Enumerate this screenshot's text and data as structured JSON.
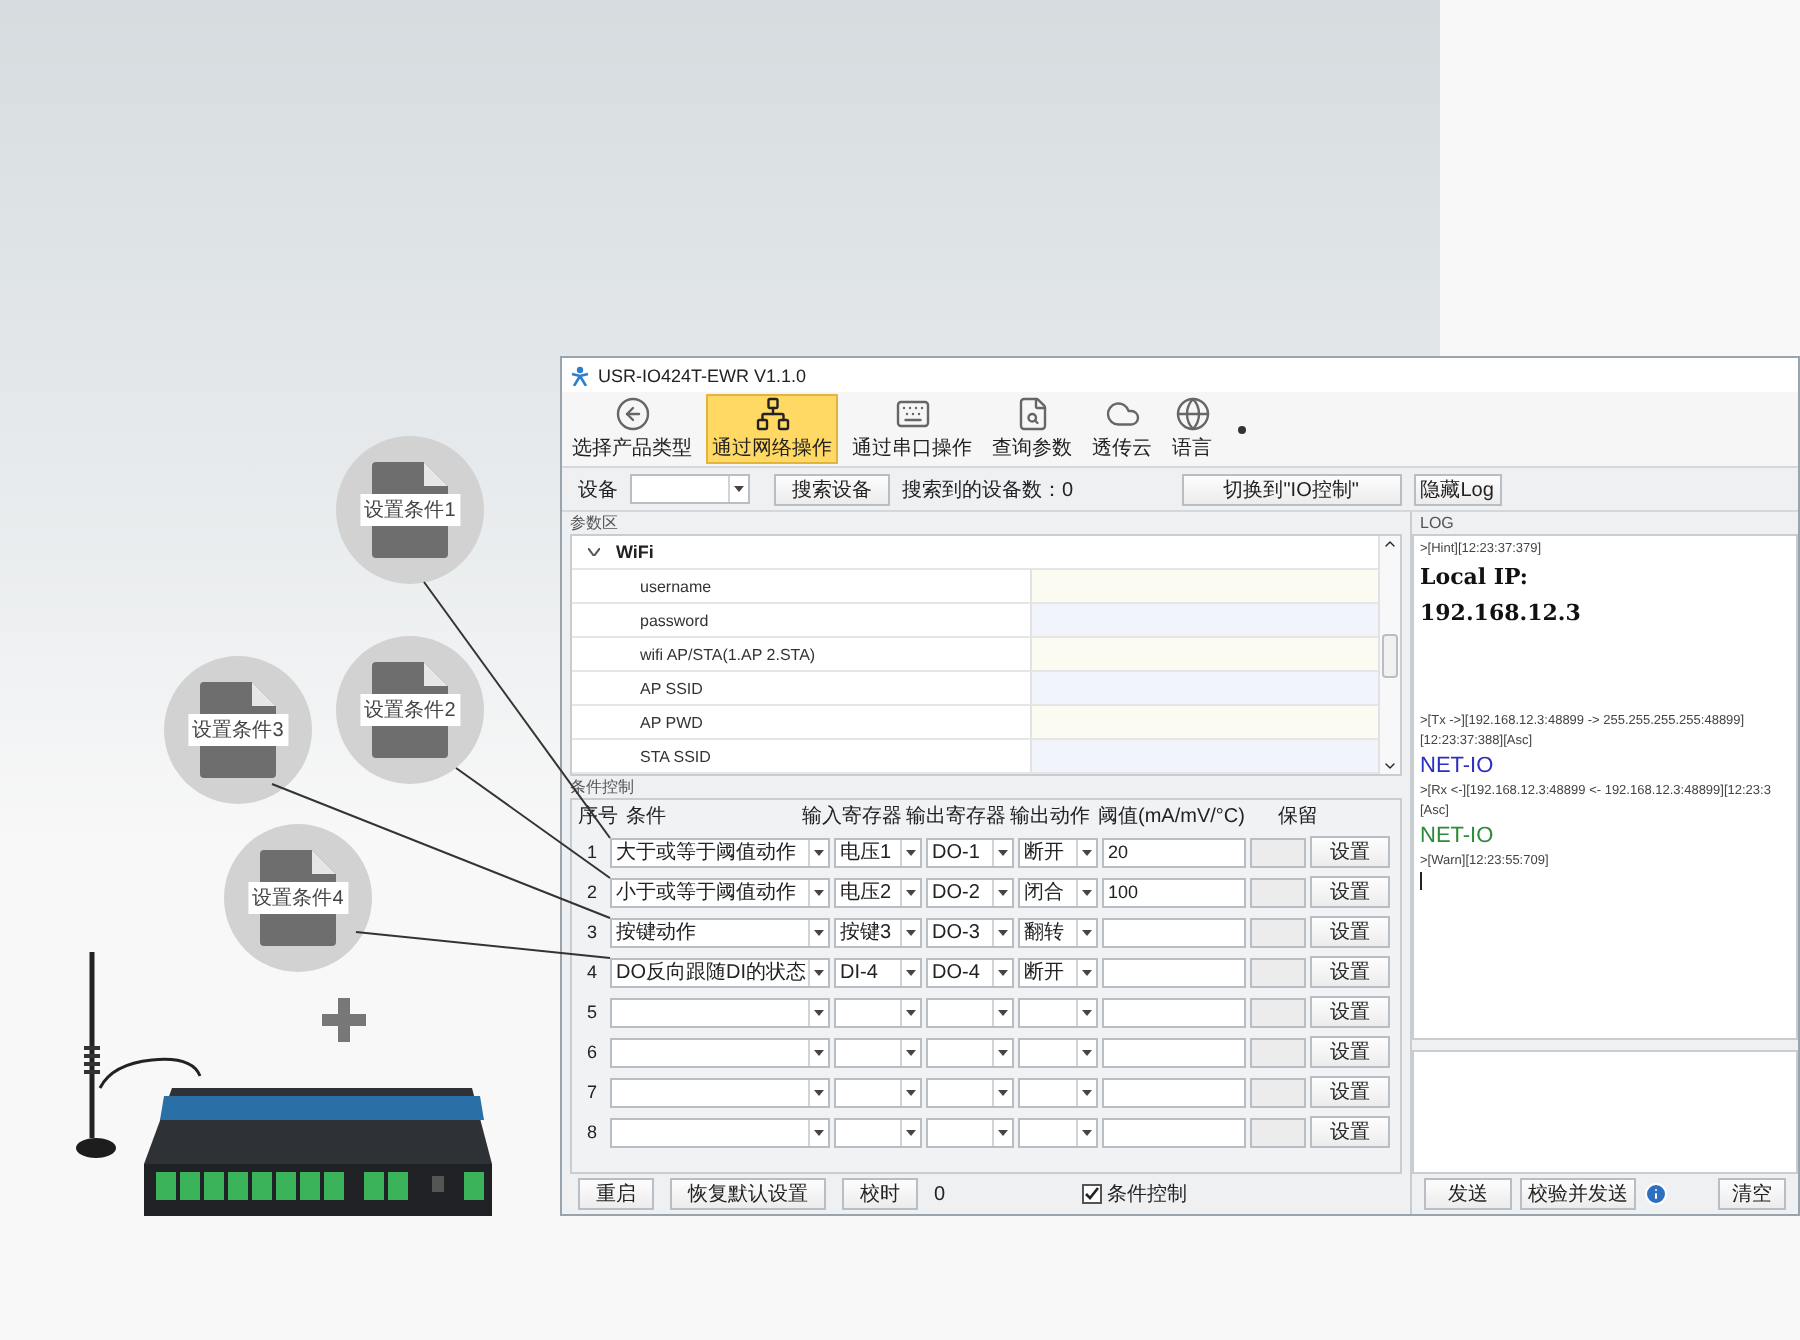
{
  "window": {
    "title": "USR-IO424T-EWR V1.1.0"
  },
  "toolbar": [
    {
      "label": "选择产品类型",
      "selected": false
    },
    {
      "label": "通过网络操作",
      "selected": true
    },
    {
      "label": "通过串口操作",
      "selected": false
    },
    {
      "label": "查询参数",
      "selected": false
    },
    {
      "label": "透传云",
      "selected": false
    },
    {
      "label": "语言",
      "selected": false
    }
  ],
  "device_bar": {
    "device_label": "设备",
    "search_button": "搜索设备",
    "found_text": "搜索到的设备数：0",
    "switch_button": "切换到\"IO控制\"",
    "hide_log_button": "隐藏Log"
  },
  "params": {
    "title": "参数区",
    "groups": [
      {
        "label": "WiFi",
        "expanded": true,
        "children": [
          {
            "label": "username"
          },
          {
            "label": "password"
          },
          {
            "label": "wifi AP/STA(1.AP 2.STA)"
          },
          {
            "label": "AP SSID"
          },
          {
            "label": "AP PWD"
          },
          {
            "label": "STA SSID"
          }
        ]
      }
    ]
  },
  "conditions": {
    "title": "条件控制",
    "columns": [
      "序号",
      "条件",
      "输入寄存器",
      "输出寄存器",
      "输出动作",
      "阈值(mA/mV/°C)",
      "保留"
    ],
    "rows": [
      {
        "index": "1",
        "condition": "大于或等于阈值动作",
        "input": "电压1",
        "output": "DO-1",
        "action": "断开",
        "threshold": "20",
        "button": "设置"
      },
      {
        "index": "2",
        "condition": "小于或等于阈值动作",
        "input": "电压2",
        "output": "DO-2",
        "action": "闭合",
        "threshold": "100",
        "button": "设置"
      },
      {
        "index": "3",
        "condition": "按键动作",
        "input": "按键3",
        "output": "DO-3",
        "action": "翻转",
        "button": "设置"
      },
      {
        "index": "4",
        "condition": "DO反向跟随DI的状态",
        "input": "DI-4",
        "output": "DO-4",
        "action": "断开",
        "button": "设置"
      },
      {
        "index": "5",
        "button": "设置"
      },
      {
        "index": "6",
        "button": "设置"
      },
      {
        "index": "7",
        "button": "设置"
      },
      {
        "index": "8",
        "button": "设置"
      }
    ]
  },
  "bottom_bar": {
    "buttons": [
      "重启",
      "恢复默认设置",
      "校时"
    ],
    "time_value": "0",
    "checkbox": {
      "label": "条件控制",
      "checked": true
    }
  },
  "log": {
    "title": "LOG",
    "lines": [
      {
        "kind": "meta",
        "text": ">[Hint][12:23:37:379]"
      },
      {
        "kind": "title",
        "text": "Local IP:"
      },
      {
        "kind": "title",
        "text": "192.168.12.3"
      },
      {
        "kind": "gap"
      },
      {
        "kind": "meta",
        "text": ">[Tx ->][192.168.12.3:48899 -> 255.255.255.255:48899]"
      },
      {
        "kind": "meta",
        "text": "[12:23:37:388][Asc]"
      },
      {
        "kind": "sent",
        "text": "NET-IO"
      },
      {
        "kind": "meta",
        "text": ">[Rx <-][192.168.12.3:48899 <- 192.168.12.3:48899][12:23:3"
      },
      {
        "kind": "meta",
        "text": "[Asc]"
      },
      {
        "kind": "received",
        "text": "NET-IO"
      },
      {
        "kind": "meta",
        "text": ">[Warn][12:23:55:709]"
      }
    ],
    "buttons": [
      "发送",
      "校验并发送",
      "清空"
    ]
  },
  "callouts": [
    {
      "label": "设置条件1"
    },
    {
      "label": "设置条件2"
    },
    {
      "label": "设置条件3"
    },
    {
      "label": "设置条件4"
    }
  ]
}
